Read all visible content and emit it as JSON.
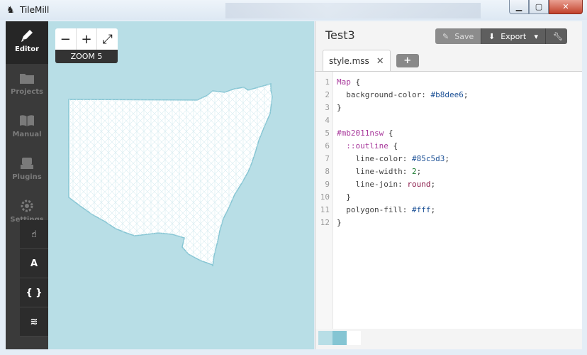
{
  "window": {
    "title": "TileMill"
  },
  "sidebar": {
    "items": [
      {
        "label": "Editor"
      },
      {
        "label": "Projects"
      },
      {
        "label": "Manual"
      },
      {
        "label": "Plugins"
      },
      {
        "label": "Settings"
      }
    ],
    "tools": [
      "pointer",
      "A",
      "{ }",
      "layers"
    ]
  },
  "map": {
    "zoom_minus": "−",
    "zoom_plus": "+",
    "zoom_fullscreen": "⤢",
    "zoom_label": "ZOOM 5",
    "background": "#b8dee6"
  },
  "editor": {
    "project_title": "Test3",
    "save_label": "Save",
    "export_label": "Export",
    "tab_label": "style.mss",
    "add_tab": "+",
    "code_lines": [
      "Map {",
      "  background-color: #b8dee6;",
      "}",
      "",
      "#mb2011nsw {",
      "  ::outline {",
      "    line-color: #85c5d3;",
      "    line-width: 2;",
      "    line-join: round;",
      "  }",
      "  polygon-fill: #fff;",
      "}"
    ],
    "line_numbers": [
      "1",
      "2",
      "3",
      "4",
      "5",
      "6",
      "7",
      "8",
      "9",
      "10",
      "11",
      "12"
    ],
    "swatches": [
      "#b8dee6",
      "#85c5d3",
      "#ffffff"
    ]
  }
}
